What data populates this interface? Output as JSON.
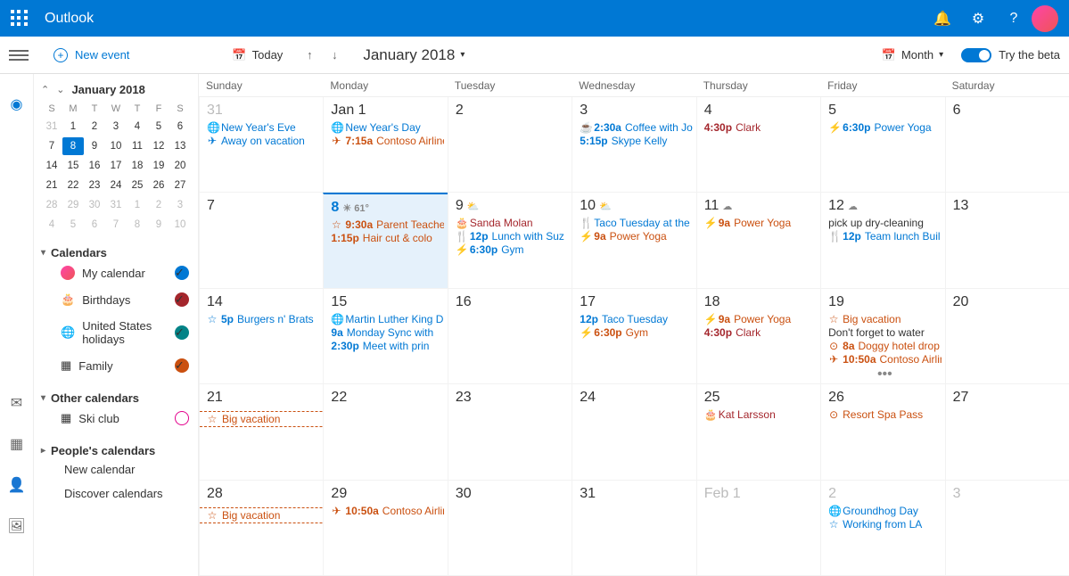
{
  "header": {
    "brand": "Outlook"
  },
  "toolbar": {
    "new": "New event",
    "today": "Today",
    "month": "January 2018",
    "view": "Month",
    "beta": "Try the beta"
  },
  "mini": {
    "label": "January 2018",
    "dow": [
      "S",
      "M",
      "T",
      "W",
      "T",
      "F",
      "S"
    ],
    "rows": [
      [
        "31",
        "1",
        "2",
        "3",
        "4",
        "5",
        "6"
      ],
      [
        "7",
        "8",
        "9",
        "10",
        "11",
        "12",
        "13"
      ],
      [
        "14",
        "15",
        "16",
        "17",
        "18",
        "19",
        "20"
      ],
      [
        "21",
        "22",
        "23",
        "24",
        "25",
        "26",
        "27"
      ],
      [
        "28",
        "29",
        "30",
        "31",
        "1",
        "2",
        "3"
      ],
      [
        "4",
        "5",
        "6",
        "7",
        "8",
        "9",
        "10"
      ]
    ]
  },
  "nav": {
    "calendars": "Calendars",
    "my": "My calendar",
    "bday": "Birthdays",
    "us": "United States holidays",
    "family": "Family",
    "other": "Other calendars",
    "ski": "Ski club",
    "people": "People's calendars",
    "newcal": "New calendar",
    "discover": "Discover calendars"
  },
  "days": [
    "Sunday",
    "Monday",
    "Tuesday",
    "Wednesday",
    "Thursday",
    "Friday",
    "Saturday"
  ],
  "cells": [
    {
      "num": "31",
      "dim": true,
      "ev": [
        {
          "c": "blue",
          "i": "🌐",
          "t": "",
          "x": "New Year's Eve"
        },
        {
          "c": "blue",
          "i": "✈",
          "t": "",
          "x": "Away on vacation"
        }
      ]
    },
    {
      "num": "Jan 1",
      "ev": [
        {
          "c": "blue",
          "i": "🌐",
          "t": "",
          "x": "New Year's Day"
        },
        {
          "c": "orange",
          "i": "✈",
          "t": "7:15a",
          "x": "Contoso Airline"
        }
      ]
    },
    {
      "num": "2",
      "ev": []
    },
    {
      "num": "3",
      "ev": [
        {
          "c": "blue",
          "i": "☕",
          "t": "2:30a",
          "x": "Coffee with Jo"
        },
        {
          "c": "blue",
          "i": "",
          "t": "5:15p",
          "x": "Skype Kelly"
        }
      ]
    },
    {
      "num": "4",
      "ev": [
        {
          "c": "red",
          "i": "",
          "t": "4:30p",
          "x": "Clark"
        }
      ]
    },
    {
      "num": "5",
      "ev": [
        {
          "c": "blue",
          "i": "⚡",
          "t": "6:30p",
          "x": "Power Yoga"
        }
      ]
    },
    {
      "num": "6",
      "ev": []
    },
    {
      "num": "7",
      "ev": []
    },
    {
      "num": "8",
      "sel": true,
      "wx": "☀ 61°",
      "ev": [
        {
          "c": "orange",
          "i": "☆",
          "t": "9:30a",
          "x": "Parent Teacher"
        },
        {
          "c": "orange",
          "i": "",
          "t": "1:15p",
          "x": "Hair cut & colo"
        }
      ]
    },
    {
      "num": "9",
      "wi": "⛅",
      "ev": [
        {
          "c": "red",
          "i": "🎂",
          "t": "",
          "x": "Sanda Molan"
        },
        {
          "c": "blue",
          "i": "🍴",
          "t": "12p",
          "x": "Lunch with Suz"
        },
        {
          "c": "blue",
          "i": "⚡",
          "t": "6:30p",
          "x": "Gym"
        }
      ]
    },
    {
      "num": "10",
      "wi": "⛅",
      "ev": [
        {
          "c": "blue",
          "i": "🍴",
          "t": "",
          "x": "Taco Tuesday at the"
        },
        {
          "c": "orange",
          "i": "⚡",
          "t": "9a",
          "x": "Power Yoga"
        }
      ]
    },
    {
      "num": "11",
      "wi": "☁",
      "ev": [
        {
          "c": "orange",
          "i": "⚡",
          "t": "9a",
          "x": "Power Yoga"
        }
      ]
    },
    {
      "num": "12",
      "wi": "☁",
      "ev": [
        {
          "c": "plain",
          "i": "",
          "t": "",
          "x": "pick up dry-cleaning"
        },
        {
          "c": "blue",
          "i": "🍴",
          "t": "12p",
          "x": "Team lunch Buil"
        }
      ]
    },
    {
      "num": "13",
      "ev": []
    },
    {
      "num": "14",
      "ev": [
        {
          "c": "blue",
          "i": "☆",
          "t": "5p",
          "x": "Burgers n' Brats"
        }
      ]
    },
    {
      "num": "15",
      "ev": [
        {
          "c": "blue",
          "i": "🌐",
          "t": "",
          "x": "Martin Luther King D"
        },
        {
          "c": "blue",
          "i": "",
          "t": "9a",
          "x": "Monday Sync with"
        },
        {
          "c": "blue",
          "i": "",
          "t": "2:30p",
          "x": "Meet with prin"
        }
      ]
    },
    {
      "num": "16",
      "ev": []
    },
    {
      "num": "17",
      "ev": [
        {
          "c": "blue",
          "i": "",
          "t": "12p",
          "x": "Taco Tuesday"
        },
        {
          "c": "orange",
          "i": "⚡",
          "t": "6:30p",
          "x": "Gym"
        }
      ]
    },
    {
      "num": "18",
      "ev": [
        {
          "c": "orange",
          "i": "⚡",
          "t": "9a",
          "x": "Power Yoga"
        },
        {
          "c": "red",
          "i": "",
          "t": "4:30p",
          "x": "Clark"
        }
      ]
    },
    {
      "num": "19",
      "ev": [
        {
          "c": "orange",
          "i": "☆",
          "t": "",
          "x": "Big vacation"
        },
        {
          "c": "plain",
          "i": "",
          "t": "",
          "x": "Don't forget to water"
        },
        {
          "c": "orange",
          "i": "⊙",
          "t": "8a",
          "x": "Doggy hotel drop"
        },
        {
          "c": "orange",
          "i": "✈",
          "t": "10:50a",
          "x": "Contoso Airlin"
        }
      ],
      "more": "•••"
    },
    {
      "num": "20",
      "ev": []
    },
    {
      "num": "21",
      "banner": {
        "c": "orange",
        "i": "☆",
        "x": "Big vacation"
      },
      "ev": []
    },
    {
      "num": "22",
      "ev": []
    },
    {
      "num": "23",
      "ev": []
    },
    {
      "num": "24",
      "ev": []
    },
    {
      "num": "25",
      "ev": [
        {
          "c": "red",
          "i": "🎂",
          "t": "",
          "x": "Kat Larsson"
        }
      ]
    },
    {
      "num": "26",
      "ev": [
        {
          "c": "orange",
          "i": "⊙",
          "t": "",
          "x": "Resort Spa Pass"
        }
      ]
    },
    {
      "num": "27",
      "ev": []
    },
    {
      "num": "28",
      "banner": {
        "c": "orange",
        "i": "☆",
        "x": "Big vacation"
      },
      "ev": []
    },
    {
      "num": "29",
      "ev": [
        {
          "c": "orange",
          "i": "✈",
          "t": "10:50a",
          "x": "Contoso Airlin"
        }
      ]
    },
    {
      "num": "30",
      "ev": []
    },
    {
      "num": "31",
      "ev": []
    },
    {
      "num": "Feb 1",
      "dim": true,
      "ev": []
    },
    {
      "num": "2",
      "dim": true,
      "ev": [
        {
          "c": "blue",
          "i": "🌐",
          "t": "",
          "x": "Groundhog Day"
        },
        {
          "c": "blue",
          "i": "☆",
          "t": "",
          "x": "Working from LA"
        }
      ]
    },
    {
      "num": "3",
      "dim": true,
      "ev": []
    }
  ]
}
